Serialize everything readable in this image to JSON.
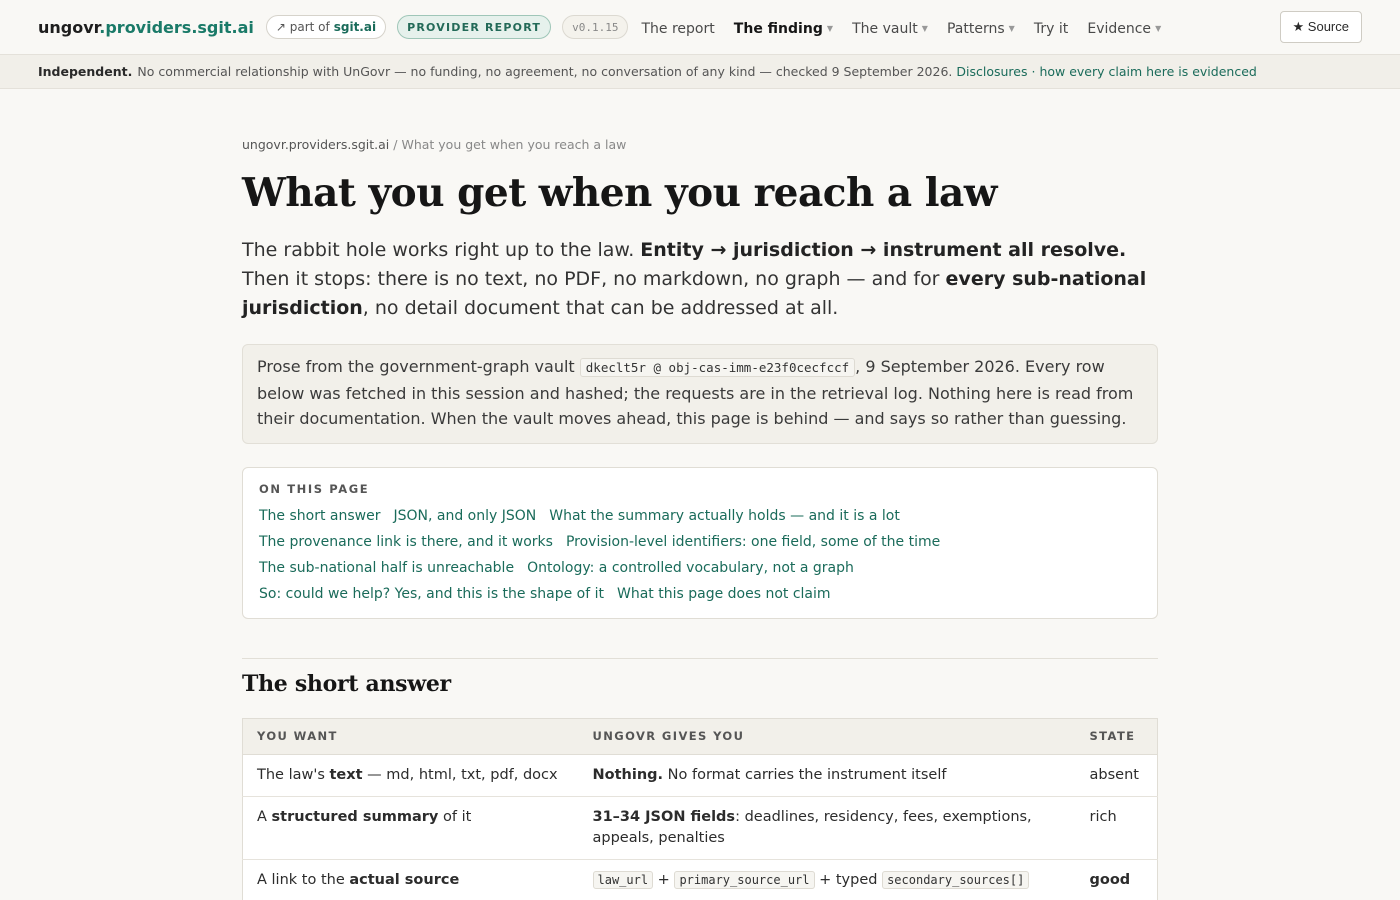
{
  "header": {
    "brand_main": "ungovr",
    "brand_accent": ".providers.sgit.ai",
    "partof_prefix": "↗ part of",
    "partof_site": "sgit.ai",
    "report_badge": "PROVIDER REPORT",
    "version": "v0.1.15",
    "nav": [
      {
        "label": "The report",
        "caret": false
      },
      {
        "label": "The finding",
        "caret": true,
        "active": true
      },
      {
        "label": "The vault",
        "caret": true
      },
      {
        "label": "Patterns",
        "caret": true
      },
      {
        "label": "Try it",
        "caret": false
      },
      {
        "label": "Evidence",
        "caret": true
      }
    ],
    "source_button": "★ Source"
  },
  "strip": {
    "lead": "Independent.",
    "text": "No commercial relationship with UnGovr — no funding, no agreement, no conversation of any kind — checked 9 September 2026.",
    "link1": "Disclosures",
    "sep": "·",
    "link2": "how every claim here is evidenced"
  },
  "breadcrumb": {
    "root": "ungovr.providers.sgit.ai",
    "sep": " / ",
    "current": "What you get when you reach a law"
  },
  "page": {
    "title": "What you get when you reach a law",
    "lede": {
      "p1": "The rabbit hole works right up to the law. ",
      "b1": "Entity → jurisdiction → instrument all resolve.",
      "p2": " Then it stops: there is no text, no PDF, no markdown, no graph — and for ",
      "b2": "every sub-national jurisdiction",
      "p3": ", no detail document that can be addressed at all."
    },
    "note": {
      "p1": "Prose from the government-graph vault ",
      "code": "dkeclt5r @ obj-cas-imm-e23f0cecfccf",
      "p2": ", 9 September 2026. Every row below was fetched in this session and hashed; the requests are in the retrieval log. Nothing here is read from their documentation. When the vault moves ahead, this page is behind — and says so rather than guessing."
    }
  },
  "toc": {
    "heading": "ON THIS PAGE",
    "rows": [
      [
        "The short answer",
        "JSON, and only JSON",
        "What the summary actually holds — and it is a lot"
      ],
      [
        "The provenance link is there, and it works",
        "Provision-level identifiers: one field, some of the time"
      ],
      [
        "The sub-national half is unreachable",
        "Ontology: a controlled vocabulary, not a graph"
      ],
      [
        "So: could we help? Yes, and this is the shape of it",
        "What this page does not claim"
      ]
    ]
  },
  "short_answer": {
    "heading": "The short answer",
    "columns": [
      "YOU WANT",
      "UNGOVR GIVES YOU",
      "STATE"
    ],
    "rows": [
      {
        "want_pre": "The law's ",
        "want_b": "text",
        "want_post": " — md, html, txt, pdf, docx",
        "give_b": "Nothing.",
        "give_post": " No format carries the instrument itself",
        "state": "absent"
      },
      {
        "want_pre": "A ",
        "want_b": "structured summary",
        "want_post": " of it",
        "give_b": "31–34 JSON fields",
        "give_post": ": deadlines, residency, fees, exemptions, appeals, penalties",
        "state": "rich"
      },
      {
        "want_pre": "A link to the ",
        "want_b": "actual source",
        "want_post": "",
        "code1": "law_url",
        "plus1": " + ",
        "code2": "primary_source_url",
        "plus2": " + typed ",
        "code3": "secondary_sources[]",
        "state": "good"
      }
    ]
  }
}
